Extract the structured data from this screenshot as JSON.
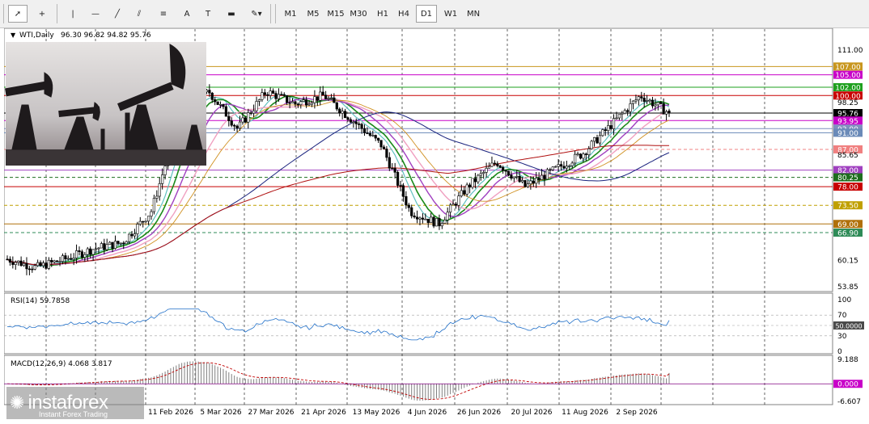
{
  "toolbar": {
    "tools": [
      {
        "name": "cursor-arrow-icon",
        "glyph": "➚"
      },
      {
        "name": "crosshair-icon",
        "glyph": "+"
      },
      {
        "name": "vertical-line-icon",
        "glyph": "|"
      },
      {
        "name": "horizontal-line-icon",
        "glyph": "—"
      },
      {
        "name": "trendline-icon",
        "glyph": "╱"
      },
      {
        "name": "channel-icon",
        "glyph": "⫽"
      },
      {
        "name": "fibonacci-icon",
        "glyph": "≡"
      },
      {
        "name": "text-icon",
        "glyph": "A"
      },
      {
        "name": "text-label-icon",
        "glyph": "T"
      },
      {
        "name": "rectangle-icon",
        "glyph": "▬"
      },
      {
        "name": "shapes-dropdown-icon",
        "glyph": "✎▾"
      }
    ],
    "timeframes": [
      "M1",
      "M5",
      "M15",
      "M30",
      "H1",
      "H4",
      "D1",
      "W1",
      "MN"
    ],
    "active_timeframe": "D1"
  },
  "header": {
    "symbol_label": "WTI,Daily",
    "ohlc": "96.30 96.82 94.82 95.76"
  },
  "price_scale": {
    "ticks": [
      "111.00",
      "98.25",
      "85.65",
      "60.15",
      "53.85"
    ]
  },
  "levels": [
    {
      "label": "107.00",
      "value": 107.0,
      "color": "#c8961e",
      "bg": "#c8961e"
    },
    {
      "label": "105.00",
      "value": 105.0,
      "color": "#c800c8",
      "bg": "#c800c8"
    },
    {
      "label": "102.00",
      "value": 102.0,
      "color": "#1ea01e",
      "bg": "#1ea01e"
    },
    {
      "label": "100.00",
      "value": 100.0,
      "color": "#c80000",
      "bg": "#c80000"
    },
    {
      "label": "95.76",
      "value": 95.76,
      "color": "#000000",
      "bg": "#000000"
    },
    {
      "label": "93.95",
      "value": 93.95,
      "color": "#c800c8",
      "bg": "#c800c8"
    },
    {
      "label": "92.00",
      "value": 92.0,
      "color": "#7f8fbf",
      "bg": "#7f8fbf"
    },
    {
      "label": "91.00",
      "value": 91.0,
      "color": "#6a8ab8",
      "bg": "#6a8ab8"
    },
    {
      "label": "87.00",
      "value": 87.0,
      "color": "#f08080",
      "bg": "#f08080"
    },
    {
      "label": "82.00",
      "value": 82.0,
      "color": "#a040c0",
      "bg": "#a040c0"
    },
    {
      "label": "80.25",
      "value": 80.25,
      "color": "#1e6e1e",
      "bg": "#1e6e1e"
    },
    {
      "label": "78.00",
      "value": 78.0,
      "color": "#c80000",
      "bg": "#c80000"
    },
    {
      "label": "73.50",
      "value": 73.5,
      "color": "#c0a000",
      "bg": "#c0a000"
    },
    {
      "label": "69.00",
      "value": 69.0,
      "color": "#b0700a",
      "bg": "#b0700a"
    },
    {
      "label": "66.90",
      "value": 66.9,
      "color": "#2e8b57",
      "bg": "#2e8b57"
    }
  ],
  "rsi": {
    "label": "RSI(14) 59.7858",
    "ticks": [
      "100",
      "70",
      "50.0000",
      "30",
      "0"
    ]
  },
  "macd": {
    "label": "MACD(12,26,9) 4.068 3.817",
    "ticks": [
      "9.188",
      "0.000",
      "-6.607"
    ]
  },
  "dates": [
    "11 Feb 2026",
    "5 Mar 2026",
    "27 Mar 2026",
    "21 Apr 2026",
    "13 May 2026",
    "4 Jun 2026",
    "26 Jun 2026",
    "20 Jul 2026",
    "11 Aug 2026",
    "2 Sep 2026"
  ],
  "watermark": {
    "brand": "instaforex",
    "tagline": "Instant Forex Trading"
  },
  "colors": {
    "candle": "#000000",
    "ma_fast": "#1a8a1a",
    "ma_fast2": "#60c0c0",
    "ma_mid": "#a040c0",
    "ma_pink": "#f0a0c0",
    "ma_slow_orange": "#d09020",
    "ma_blue": "#1a237e",
    "ma_red": "#b01010",
    "rsi_line": "#1e6ec8",
    "macd_hist": "#808080",
    "macd_signal": "#c00000"
  },
  "chart_data": {
    "type": "candlestick",
    "title": "WTI,Daily",
    "x_dates": [
      "11 Feb 2026",
      "5 Mar 2026",
      "27 Mar 2026",
      "21 Apr 2026",
      "13 May 2026",
      "4 Jun 2026",
      "26 Jun 2026",
      "20 Jul 2026",
      "11 Aug 2026",
      "2 Sep 2026"
    ],
    "close_path": [
      {
        "date": "Jan 2026",
        "value": 60.5
      },
      {
        "date": "Jan 2026",
        "value": 58.5
      },
      {
        "date": "Feb 2026",
        "value": 60.5
      },
      {
        "date": "11 Feb 2026",
        "value": 63.0
      },
      {
        "date": "Feb 2026",
        "value": 64.5
      },
      {
        "date": "5 Mar 2026",
        "value": 72.0
      },
      {
        "date": "Mar 2026",
        "value": 95.0
      },
      {
        "date": "27 Mar 2026",
        "value": 101.0
      },
      {
        "date": "Apr 2026",
        "value": 92.0
      },
      {
        "date": "21 Apr 2026",
        "value": 101.0
      },
      {
        "date": "May 2026",
        "value": 98.0
      },
      {
        "date": "13 May 2026",
        "value": 100.0
      },
      {
        "date": "May 2026",
        "value": 94.0
      },
      {
        "date": "4 Jun 2026",
        "value": 88.0
      },
      {
        "date": "Jun 2026",
        "value": 72.0
      },
      {
        "date": "26 Jun 2026",
        "value": 69.0
      },
      {
        "date": "Jul 2026",
        "value": 78.0
      },
      {
        "date": "20 Jul 2026",
        "value": 84.0
      },
      {
        "date": "Jul 2026",
        "value": 78.0
      },
      {
        "date": "11 Aug 2026",
        "value": 82.0
      },
      {
        "date": "Aug 2026",
        "value": 86.0
      },
      {
        "date": "2 Sep 2026",
        "value": 93.0
      },
      {
        "date": "Sep 2026",
        "value": 100.0
      },
      {
        "date": "Sep 2026",
        "value": 95.76
      }
    ],
    "last_ohlc": {
      "open": 96.3,
      "high": 96.82,
      "low": 94.82,
      "close": 95.76
    },
    "ylim": [
      53.85,
      113.5
    ],
    "rsi_last": 59.7858,
    "macd_last": {
      "macd": 4.068,
      "signal": 3.817
    },
    "macd_range": [
      -6.607,
      9.188
    ]
  }
}
